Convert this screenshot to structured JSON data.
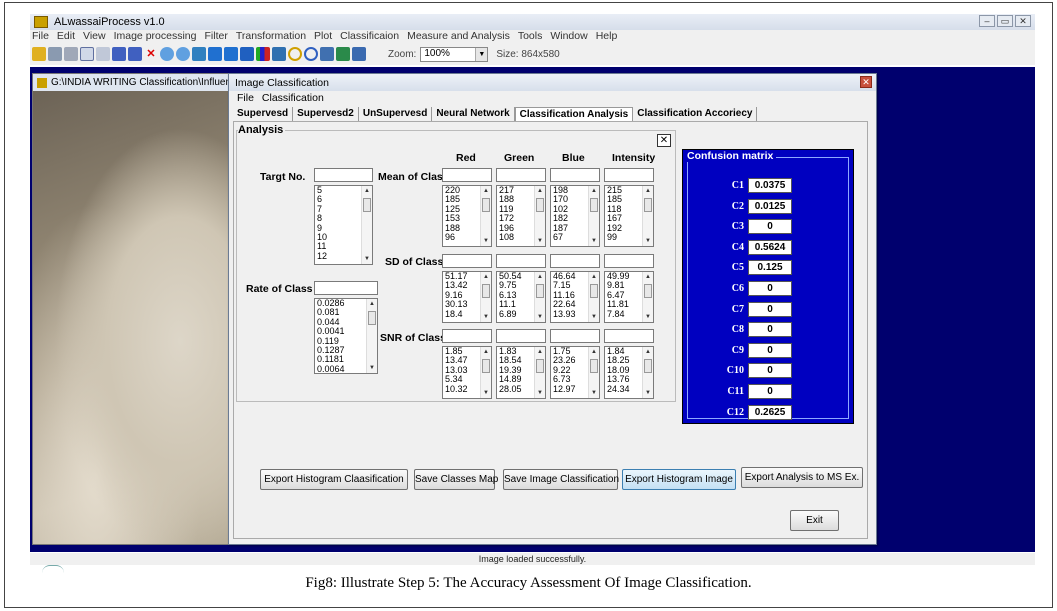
{
  "app": {
    "title": "ALwassaiProcess v1.0",
    "menu": [
      "File",
      "Edit",
      "View",
      "Image processing",
      "Filter",
      "Transformation",
      "Plot",
      "Classificaion",
      "Measure and Analysis",
      "Tools",
      "Window",
      "Help"
    ],
    "zoom_label": "Zoom:",
    "zoom_value": "100%",
    "size_label": "Size: 864x580",
    "status": "Image loaded successfully."
  },
  "image_window": {
    "title": "G:\\INDIA WRITING Classification\\Influence"
  },
  "dialog": {
    "title": "Image Classification",
    "menu": [
      "File",
      "Classification"
    ],
    "tabs": [
      "Supervesd",
      "Supervesd2",
      "UnSupervesd",
      "Neural Network",
      "Classification Analysis",
      "Classification Accoriecy"
    ],
    "active_tab": "Classification Analysis",
    "section_label": "Analysis",
    "close_glyph": "✕",
    "x_glyph": "✕",
    "column_headers": [
      "Red",
      "Green",
      "Blue",
      "Intensity"
    ],
    "labels": {
      "target_no": "Targt No.",
      "rate_of_class": "Rate of Class",
      "mean_of_class": "Mean of Class:",
      "sd_of_class": "SD of Class :",
      "snr_of_class": "SNR of Class:"
    },
    "target_list": [
      "5",
      "6",
      "7",
      "8",
      "9",
      "10",
      "11",
      "12"
    ],
    "rate_list": [
      "0.0286",
      "0.081",
      "0.044",
      "0.0041",
      "0.119",
      "0.1287",
      "0.1181",
      "0.0064"
    ],
    "mean": {
      "red": [
        "220",
        "185",
        "125",
        "153",
        "188",
        "96"
      ],
      "green": [
        "217",
        "188",
        "119",
        "172",
        "196",
        "108"
      ],
      "blue": [
        "198",
        "170",
        "102",
        "182",
        "187",
        "67"
      ],
      "intensity": [
        "215",
        "185",
        "118",
        "167",
        "192",
        "99"
      ]
    },
    "sd": {
      "red": [
        "51.17",
        "13.42",
        "9.16",
        "30.13",
        "18.4"
      ],
      "green": [
        "50.54",
        "9.75",
        "6.13",
        "11.1",
        "6.89"
      ],
      "blue": [
        "46.64",
        "7.15",
        "11.16",
        "22.64",
        "13.93"
      ],
      "intensity": [
        "49.99",
        "9.81",
        "6.47",
        "11.81",
        "7.84"
      ]
    },
    "snr": {
      "red": [
        "1.85",
        "13.47",
        "13.03",
        "5.34",
        "10.32"
      ],
      "green": [
        "1.83",
        "18.54",
        "19.39",
        "14.89",
        "28.05"
      ],
      "blue": [
        "1.75",
        "23.26",
        "9.22",
        "6.73",
        "12.97"
      ],
      "intensity": [
        "1.84",
        "18.25",
        "18.09",
        "13.76",
        "24.34"
      ]
    },
    "confusion_matrix": {
      "title": "Confusion matrix",
      "rows": [
        {
          "label": "C1",
          "value": "0.0375"
        },
        {
          "label": "C2",
          "value": "0.0125"
        },
        {
          "label": "C3",
          "value": "0"
        },
        {
          "label": "C4",
          "value": "0.5624"
        },
        {
          "label": "C5",
          "value": "0.125"
        },
        {
          "label": "C6",
          "value": "0"
        },
        {
          "label": "C7",
          "value": "0"
        },
        {
          "label": "C8",
          "value": "0"
        },
        {
          "label": "C9",
          "value": "0"
        },
        {
          "label": "C10",
          "value": "0"
        },
        {
          "label": "C11",
          "value": "0"
        },
        {
          "label": "C12",
          "value": "0.2625"
        }
      ]
    },
    "buttons": {
      "export_hist_class": "Export  Histogram Claasification",
      "save_classes_map": "Save Classes Map",
      "save_image_class": "Save Image Classification",
      "export_hist_image": "Export  Histogram Image",
      "export_analysis": "Export Analysis to MS Ex.",
      "exit": "Exit"
    }
  },
  "caption": "Fig8: Illustrate Step 5: The Accuracy Assessment Of Image Classification.",
  "colors": {
    "workspace": "#00006e",
    "confusion_panel": "#0000c0"
  }
}
